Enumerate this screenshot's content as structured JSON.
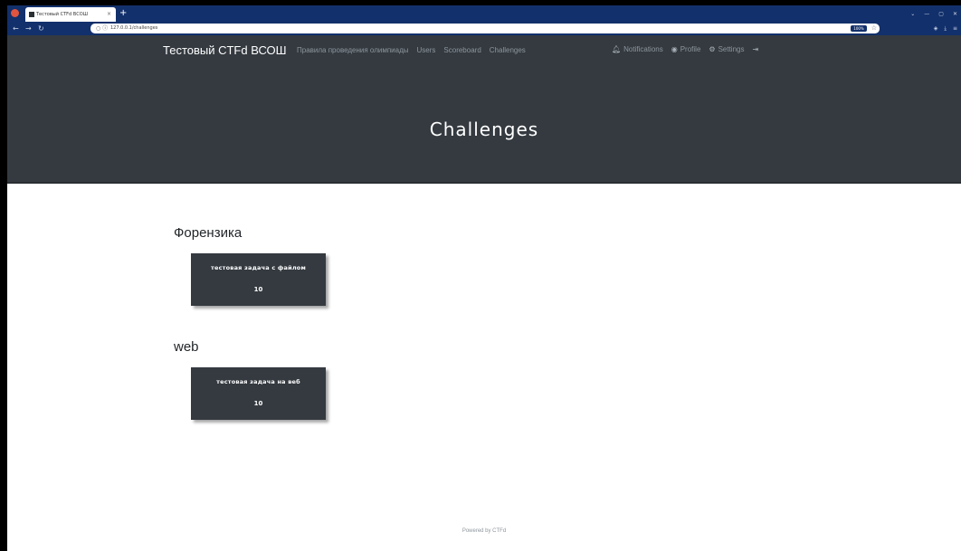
{
  "browser": {
    "tab_title": "Тестовый CTFd ВСОШ",
    "new_tab_label": "+",
    "tab_close": "×",
    "url": "127.0.0.1/challenges",
    "zoom": "100%",
    "window_controls": [
      "⌄",
      "—",
      "▢",
      "✕"
    ]
  },
  "site": {
    "brand": "Тестовый CTFd ВСОШ",
    "nav_links": [
      "Правила проведения олимпиады",
      "Users",
      "Scoreboard",
      "Challenges"
    ],
    "nav_right": {
      "notifications": "Notifications",
      "profile": "Profile",
      "settings": "Settings"
    },
    "page_title": "Challenges"
  },
  "categories": [
    {
      "name": "Форензика",
      "challenges": [
        {
          "name": "тестовая задача с файлом",
          "value": "10"
        }
      ]
    },
    {
      "name": "web",
      "challenges": [
        {
          "name": "тестовая задача на веб",
          "value": "10"
        }
      ]
    }
  ],
  "footer": "Powered by CTFd"
}
